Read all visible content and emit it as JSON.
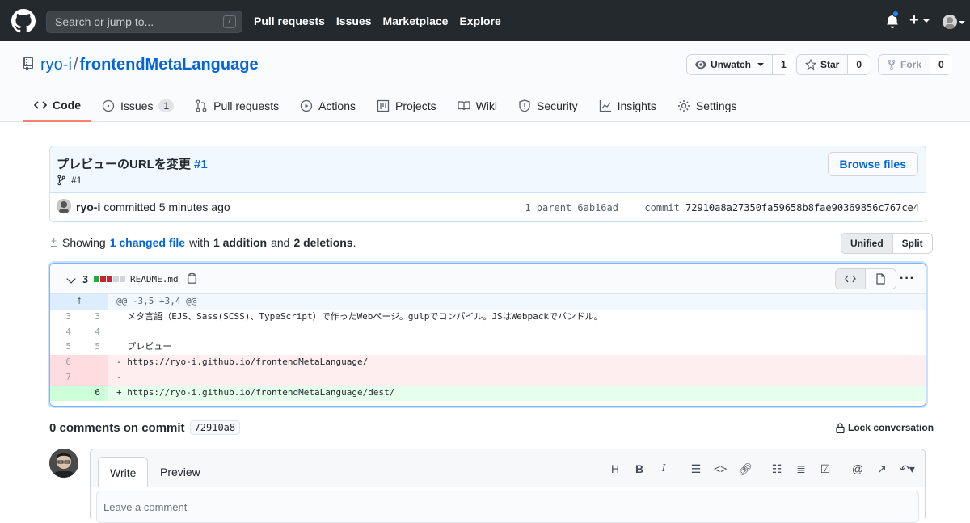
{
  "header": {
    "search_placeholder": "Search or jump to...",
    "slash_key": "/",
    "nav": [
      "Pull requests",
      "Issues",
      "Marketplace",
      "Explore"
    ]
  },
  "repo": {
    "owner": "ryo-i",
    "separator": "/",
    "name": "frontendMetaLanguage",
    "watch_label": "Unwatch",
    "watch_count": "1",
    "star_label": "Star",
    "star_count": "0",
    "fork_label": "Fork",
    "fork_count": "0"
  },
  "tabs": {
    "code": "Code",
    "issues": "Issues",
    "issues_count": "1",
    "pulls": "Pull requests",
    "actions": "Actions",
    "projects": "Projects",
    "wiki": "Wiki",
    "security": "Security",
    "insights": "Insights",
    "settings": "Settings"
  },
  "commit": {
    "title": "プレビューのURLを変更",
    "title_ref": "#1",
    "branch_ref": "#1",
    "browse_label": "Browse files",
    "author": "ryo-i",
    "action": "committed 5 minutes ago",
    "parent_label": "1 parent",
    "parent_sha": "6ab16ad",
    "commit_label": "commit",
    "commit_sha": "72910a8a27350fa59658b8fae90369856c767ce4"
  },
  "toc": {
    "showing": "Showing",
    "changed": "1 changed file",
    "with": "with",
    "additions": "1 addition",
    "and": "and",
    "deletions": "2 deletions",
    "period": ".",
    "unified": "Unified",
    "split": "Split"
  },
  "diff": {
    "count": "3",
    "filename": "README.md",
    "hunk": "@@ -3,5 +3,4 @@",
    "lines": [
      {
        "old": "3",
        "new": "3",
        "text": "  メタ言語（EJS、Sass(SCSS)、TypeScript）で作ったWebページ。gulpでコンパイル。JSはWebpackでバンドル。"
      },
      {
        "old": "4",
        "new": "4",
        "text": ""
      },
      {
        "old": "5",
        "new": "5",
        "text": "  プレビュー"
      },
      {
        "old": "6",
        "new": "",
        "text": "- https://ryo-i.github.io/frontendMetaLanguage/"
      },
      {
        "old": "7",
        "new": "",
        "text": "-"
      },
      {
        "old": "",
        "new": "6",
        "text": "+ https://ryo-i.github.io/frontendMetaLanguage/dest/"
      }
    ]
  },
  "comments": {
    "heading": "0 comments on commit",
    "sha": "72910a8",
    "lock_label": "Lock conversation",
    "write_tab": "Write",
    "preview_tab": "Preview",
    "placeholder": "Leave a comment",
    "toolbar": [
      "H",
      "B",
      "I",
      "quote",
      "code",
      "link",
      "bullet-list",
      "numbered-list",
      "task-list",
      "mention",
      "reference",
      "reply"
    ]
  }
}
